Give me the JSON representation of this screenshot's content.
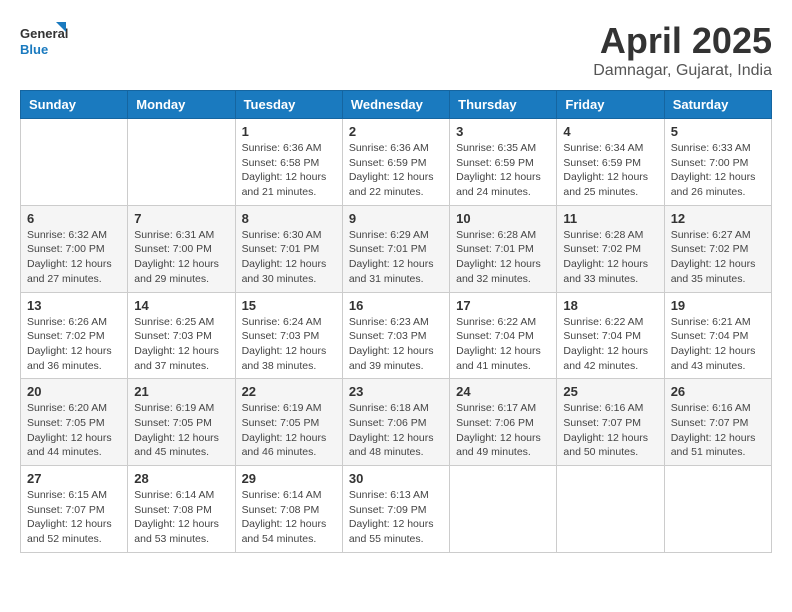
{
  "header": {
    "logo_general": "General",
    "logo_blue": "Blue",
    "month_year": "April 2025",
    "location": "Damnagar, Gujarat, India"
  },
  "weekdays": [
    "Sunday",
    "Monday",
    "Tuesday",
    "Wednesday",
    "Thursday",
    "Friday",
    "Saturday"
  ],
  "weeks": [
    [
      {
        "day": "",
        "info": ""
      },
      {
        "day": "",
        "info": ""
      },
      {
        "day": "1",
        "info": "Sunrise: 6:36 AM\nSunset: 6:58 PM\nDaylight: 12 hours and 21 minutes."
      },
      {
        "day": "2",
        "info": "Sunrise: 6:36 AM\nSunset: 6:59 PM\nDaylight: 12 hours and 22 minutes."
      },
      {
        "day": "3",
        "info": "Sunrise: 6:35 AM\nSunset: 6:59 PM\nDaylight: 12 hours and 24 minutes."
      },
      {
        "day": "4",
        "info": "Sunrise: 6:34 AM\nSunset: 6:59 PM\nDaylight: 12 hours and 25 minutes."
      },
      {
        "day": "5",
        "info": "Sunrise: 6:33 AM\nSunset: 7:00 PM\nDaylight: 12 hours and 26 minutes."
      }
    ],
    [
      {
        "day": "6",
        "info": "Sunrise: 6:32 AM\nSunset: 7:00 PM\nDaylight: 12 hours and 27 minutes."
      },
      {
        "day": "7",
        "info": "Sunrise: 6:31 AM\nSunset: 7:00 PM\nDaylight: 12 hours and 29 minutes."
      },
      {
        "day": "8",
        "info": "Sunrise: 6:30 AM\nSunset: 7:01 PM\nDaylight: 12 hours and 30 minutes."
      },
      {
        "day": "9",
        "info": "Sunrise: 6:29 AM\nSunset: 7:01 PM\nDaylight: 12 hours and 31 minutes."
      },
      {
        "day": "10",
        "info": "Sunrise: 6:28 AM\nSunset: 7:01 PM\nDaylight: 12 hours and 32 minutes."
      },
      {
        "day": "11",
        "info": "Sunrise: 6:28 AM\nSunset: 7:02 PM\nDaylight: 12 hours and 33 minutes."
      },
      {
        "day": "12",
        "info": "Sunrise: 6:27 AM\nSunset: 7:02 PM\nDaylight: 12 hours and 35 minutes."
      }
    ],
    [
      {
        "day": "13",
        "info": "Sunrise: 6:26 AM\nSunset: 7:02 PM\nDaylight: 12 hours and 36 minutes."
      },
      {
        "day": "14",
        "info": "Sunrise: 6:25 AM\nSunset: 7:03 PM\nDaylight: 12 hours and 37 minutes."
      },
      {
        "day": "15",
        "info": "Sunrise: 6:24 AM\nSunset: 7:03 PM\nDaylight: 12 hours and 38 minutes."
      },
      {
        "day": "16",
        "info": "Sunrise: 6:23 AM\nSunset: 7:03 PM\nDaylight: 12 hours and 39 minutes."
      },
      {
        "day": "17",
        "info": "Sunrise: 6:22 AM\nSunset: 7:04 PM\nDaylight: 12 hours and 41 minutes."
      },
      {
        "day": "18",
        "info": "Sunrise: 6:22 AM\nSunset: 7:04 PM\nDaylight: 12 hours and 42 minutes."
      },
      {
        "day": "19",
        "info": "Sunrise: 6:21 AM\nSunset: 7:04 PM\nDaylight: 12 hours and 43 minutes."
      }
    ],
    [
      {
        "day": "20",
        "info": "Sunrise: 6:20 AM\nSunset: 7:05 PM\nDaylight: 12 hours and 44 minutes."
      },
      {
        "day": "21",
        "info": "Sunrise: 6:19 AM\nSunset: 7:05 PM\nDaylight: 12 hours and 45 minutes."
      },
      {
        "day": "22",
        "info": "Sunrise: 6:19 AM\nSunset: 7:05 PM\nDaylight: 12 hours and 46 minutes."
      },
      {
        "day": "23",
        "info": "Sunrise: 6:18 AM\nSunset: 7:06 PM\nDaylight: 12 hours and 48 minutes."
      },
      {
        "day": "24",
        "info": "Sunrise: 6:17 AM\nSunset: 7:06 PM\nDaylight: 12 hours and 49 minutes."
      },
      {
        "day": "25",
        "info": "Sunrise: 6:16 AM\nSunset: 7:07 PM\nDaylight: 12 hours and 50 minutes."
      },
      {
        "day": "26",
        "info": "Sunrise: 6:16 AM\nSunset: 7:07 PM\nDaylight: 12 hours and 51 minutes."
      }
    ],
    [
      {
        "day": "27",
        "info": "Sunrise: 6:15 AM\nSunset: 7:07 PM\nDaylight: 12 hours and 52 minutes."
      },
      {
        "day": "28",
        "info": "Sunrise: 6:14 AM\nSunset: 7:08 PM\nDaylight: 12 hours and 53 minutes."
      },
      {
        "day": "29",
        "info": "Sunrise: 6:14 AM\nSunset: 7:08 PM\nDaylight: 12 hours and 54 minutes."
      },
      {
        "day": "30",
        "info": "Sunrise: 6:13 AM\nSunset: 7:09 PM\nDaylight: 12 hours and 55 minutes."
      },
      {
        "day": "",
        "info": ""
      },
      {
        "day": "",
        "info": ""
      },
      {
        "day": "",
        "info": ""
      }
    ]
  ]
}
